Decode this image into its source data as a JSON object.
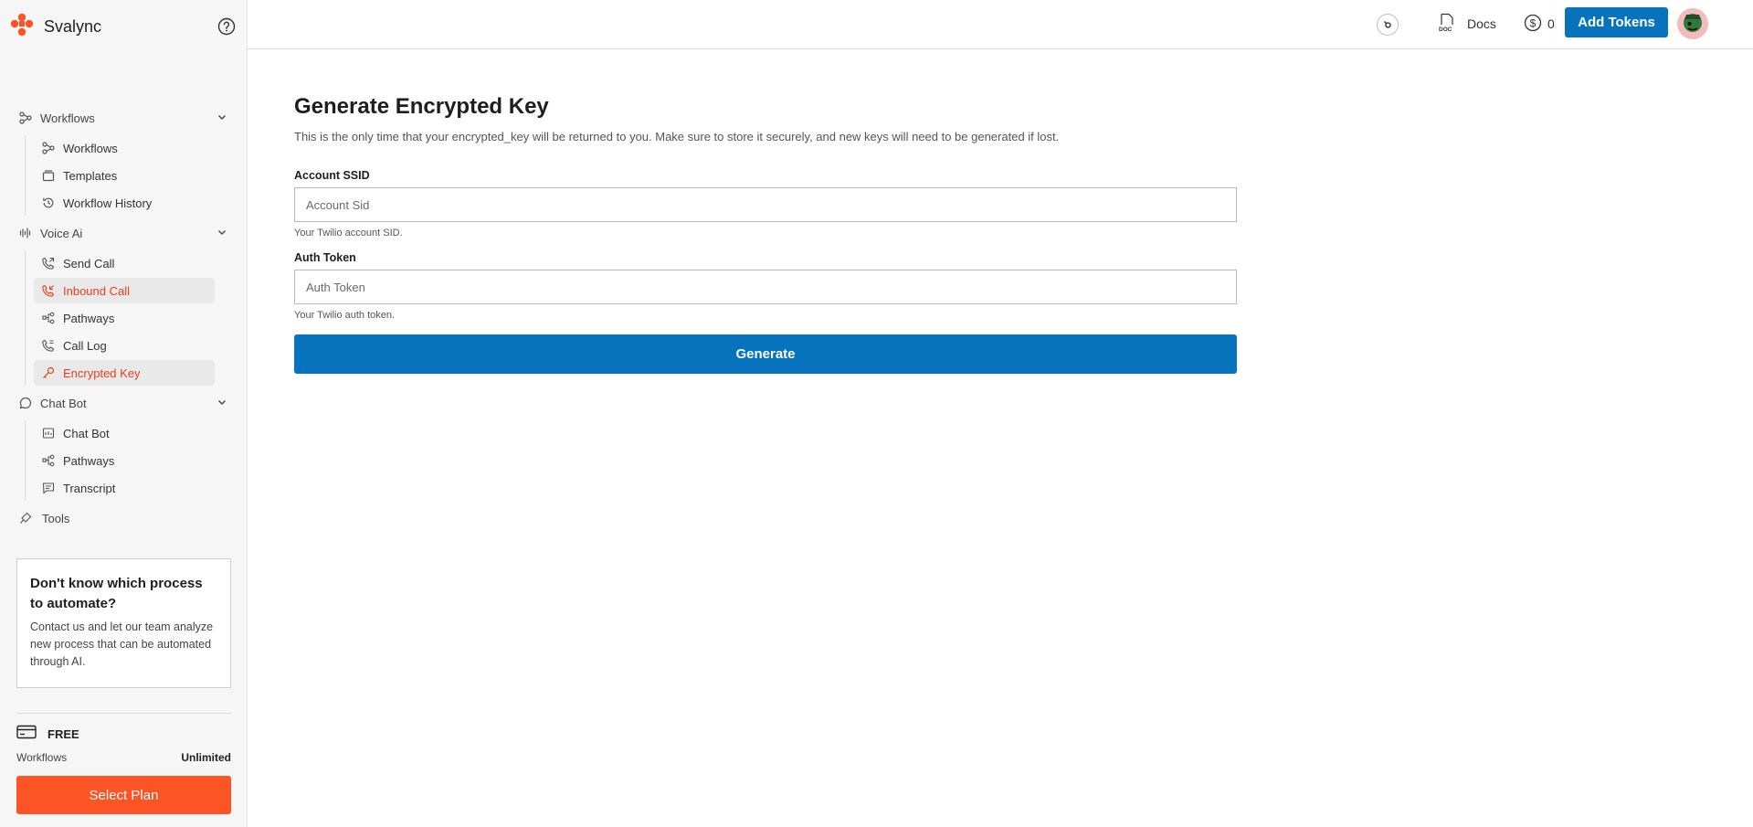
{
  "brand": {
    "name": "Svalync"
  },
  "sidebar": {
    "groups": [
      {
        "label": "Workflows",
        "items": [
          {
            "label": "Workflows"
          },
          {
            "label": "Templates"
          },
          {
            "label": "Workflow History"
          }
        ]
      },
      {
        "label": "Voice Ai",
        "items": [
          {
            "label": "Send Call"
          },
          {
            "label": "Inbound Call"
          },
          {
            "label": "Pathways"
          },
          {
            "label": "Call Log"
          },
          {
            "label": "Encrypted Key"
          }
        ]
      },
      {
        "label": "Chat Bot",
        "items": [
          {
            "label": "Chat Bot"
          },
          {
            "label": "Pathways"
          },
          {
            "label": "Transcript"
          }
        ]
      }
    ],
    "tools_label": "Tools",
    "promo": {
      "title": "Don't know which process to automate?",
      "text": "Contact us and let our team analyze new process that can be automated through AI."
    },
    "plan": {
      "name": "FREE",
      "quota_label": "Workflows",
      "quota_value": "Unlimited",
      "button_label": "Select Plan"
    }
  },
  "topbar": {
    "docs_label": "Docs",
    "token_count": "0",
    "add_tokens_label": "Add Tokens"
  },
  "main": {
    "title": "Generate Encrypted Key",
    "description": "This is the only time that your encrypted_key will be returned to you. Make sure to store it securely, and new keys will need to be generated if lost.",
    "fields": [
      {
        "label": "Account SSID",
        "placeholder": "Account Sid",
        "value": "",
        "help": "Your Twilio account SID."
      },
      {
        "label": "Auth Token",
        "placeholder": "Auth Token",
        "value": "",
        "help": "Your Twilio auth token."
      }
    ],
    "button_label": "Generate"
  },
  "colors": {
    "accent_orange": "#fd5426",
    "active_text": "#ea3d1c",
    "primary_blue": "#0773bc"
  }
}
